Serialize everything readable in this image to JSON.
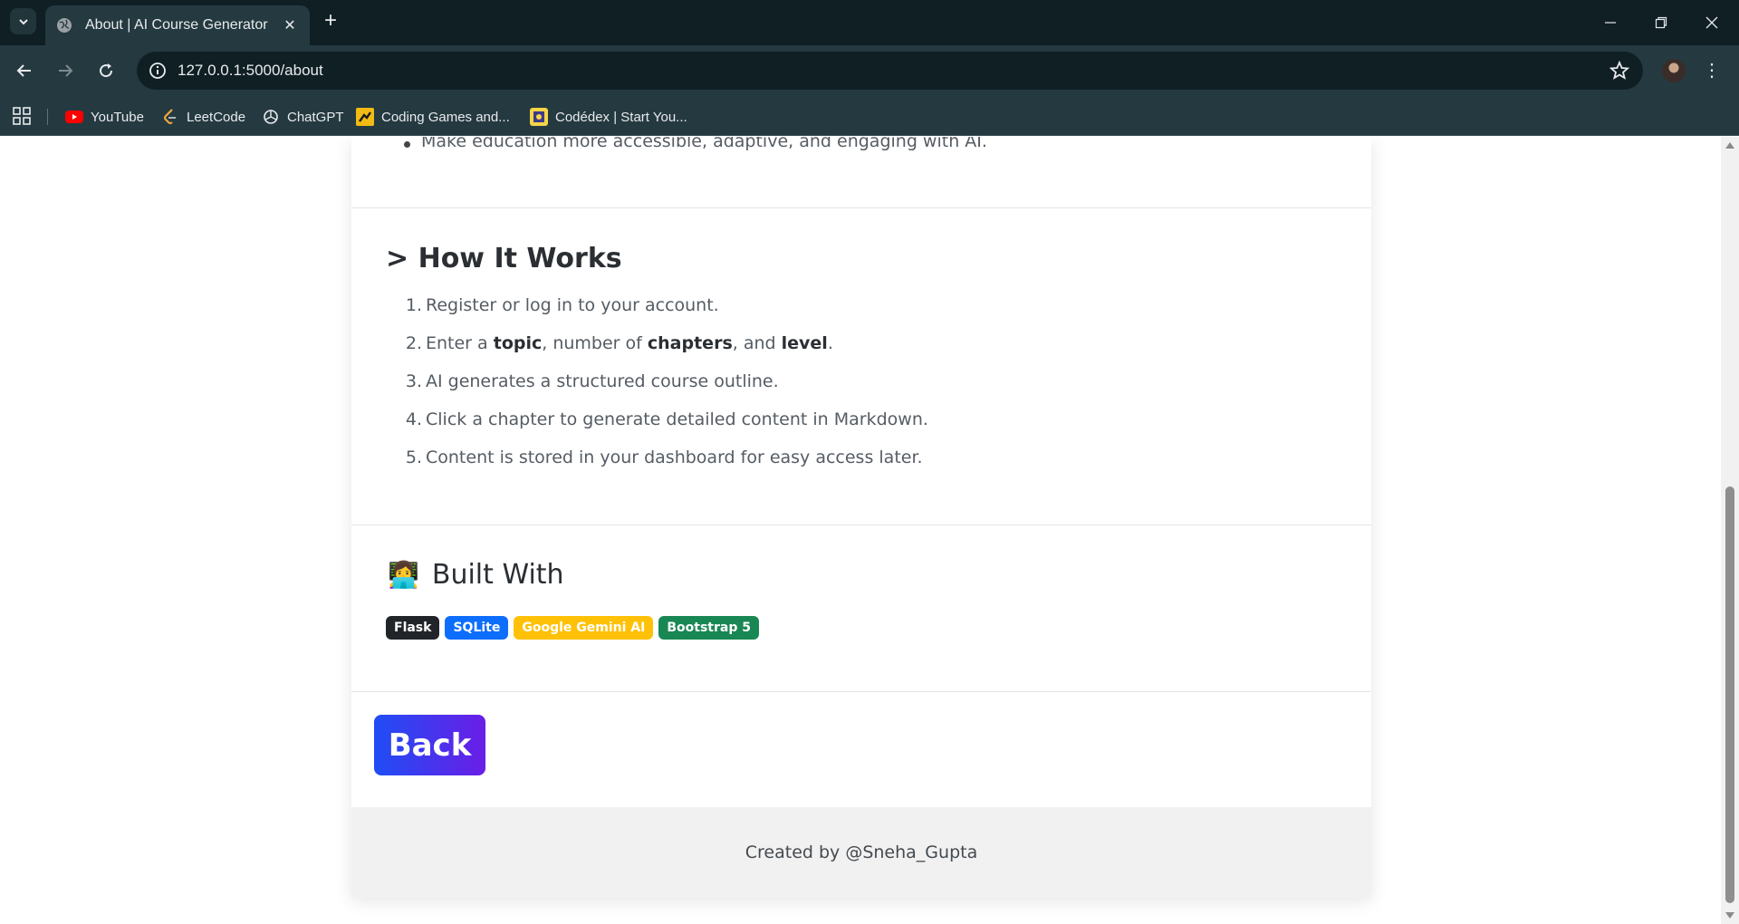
{
  "browser": {
    "tab_title": "About | AI Course Generator",
    "url": "127.0.0.1:5000/about",
    "bookmarks": [
      {
        "label": "YouTube",
        "icon": "youtube-icon"
      },
      {
        "label": "LeetCode",
        "icon": "leetcode-icon"
      },
      {
        "label": "ChatGPT",
        "icon": "chatgpt-icon"
      },
      {
        "label": "Coding Games and...",
        "icon": "codingame-icon"
      },
      {
        "label": "Codédex | Start You...",
        "icon": "codedex-icon"
      }
    ]
  },
  "page": {
    "top_bullet": "Make education more accessible, adaptive, and engaging with AI.",
    "how_it_works": {
      "heading": "> How It Works",
      "steps": [
        {
          "num": "1.",
          "text": "Register or log in to your account."
        },
        {
          "num": "2.",
          "parts": [
            "Enter a ",
            "topic",
            ", number of ",
            "chapters",
            ", and ",
            "level",
            "."
          ]
        },
        {
          "num": "3.",
          "text": "AI generates a structured course outline."
        },
        {
          "num": "4.",
          "text": "Click a chapter to generate detailed content in Markdown."
        },
        {
          "num": "5.",
          "text": "Content is stored in your dashboard for easy access later."
        }
      ]
    },
    "built_with": {
      "emoji": "👩‍💻",
      "heading": "Built With",
      "badges": [
        {
          "label": "Flask",
          "bg": "#212529",
          "fg": "#ffffff"
        },
        {
          "label": "SQLite",
          "bg": "#0d6efd",
          "fg": "#ffffff"
        },
        {
          "label": "Google Gemini AI",
          "bg": "#ffc107",
          "fg": "#ffffff"
        },
        {
          "label": "Bootstrap 5",
          "bg": "#198754",
          "fg": "#ffffff"
        }
      ]
    },
    "back_button": "Back",
    "footer": "Created by @Sneha_Gupta"
  }
}
